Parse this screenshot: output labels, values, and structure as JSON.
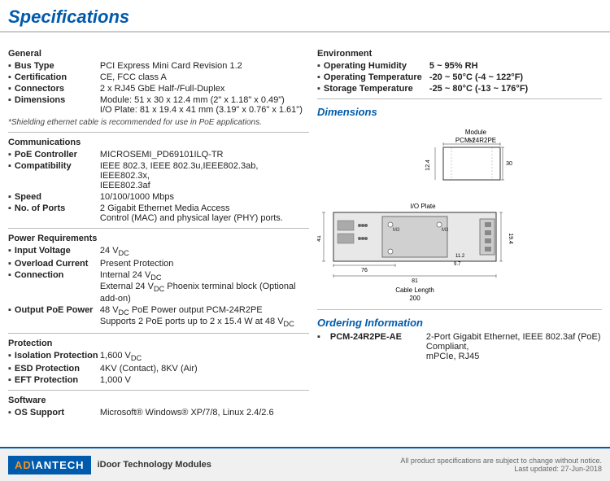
{
  "page": {
    "title": "Specifications"
  },
  "footer": {
    "logo": "AD⋆ANTECH",
    "tagline": "iDoor Technology Modules",
    "note": "All product specifications are subject to change without notice.",
    "date": "Last updated: 27-Jun-2018"
  },
  "left": {
    "general": {
      "title": "General",
      "items": [
        {
          "label": "Bus Type",
          "value": "PCI Express Mini Card Revision 1.2"
        },
        {
          "label": "Certification",
          "value": "CE, FCC class A"
        },
        {
          "label": "Connectors",
          "value": "2 x RJ45 GbE Half-/Full-Duplex"
        },
        {
          "label": "Dimensions",
          "value": "Module: 51 x 30 x 12.4 mm (2\" x 1.18\" x 0.49\")\nI/O Plate: 81 x 19.4 x 41 mm (3.19\" x 0.76\" x 1.61\")"
        }
      ],
      "note": "*Shielding ethernet cable is recommended for use in PoE applications."
    },
    "communications": {
      "title": "Communications",
      "items": [
        {
          "label": "PoE Controller",
          "value": "MICROSEMI_PD69101ILQ-TR"
        },
        {
          "label": "Compatibility",
          "value": "IEEE 802.3, IEEE 802.3u,IEEE802.3ab, IEEE802.3x,\nIEEE802.3af"
        },
        {
          "label": "Speed",
          "value": "10/100/1000 Mbps"
        },
        {
          "label": "No. of Ports",
          "value": "2 Gigabit Ethernet Media Access\nControl (MAC) and physical layer (PHY) ports."
        }
      ]
    },
    "power": {
      "title": "Power Requirements",
      "items": [
        {
          "label": "Input Voltage",
          "value": "24 VDC"
        },
        {
          "label": "Overload Current",
          "value": "Present Protection"
        },
        {
          "label": "Connection",
          "value": "Internal 24 VDC\nExternal 24 VDC Phoenix terminal block (Optional add-on)"
        },
        {
          "label": "Output PoE Power",
          "value": "48 VDC PoE Power output PCM-24R2PE\nSupports 2 PoE ports up to 2 x 15.4 W at 48 VDC"
        }
      ]
    },
    "protection": {
      "title": "Protection",
      "items": [
        {
          "label": "Isolation Protection",
          "value": "1,600 VDC"
        },
        {
          "label": "ESD Protection",
          "value": "4KV (Contact), 8KV (Air)"
        },
        {
          "label": "EFT Protection",
          "value": "1,000 V"
        }
      ]
    },
    "software": {
      "title": "Software",
      "items": [
        {
          "label": "OS Support",
          "value": "Microsoft® Windows® XP/7/8, Linux 2.4/2.6"
        }
      ]
    }
  },
  "right": {
    "environment": {
      "title": "Environment",
      "items": [
        {
          "label": "Operating Humidity",
          "value": "5 ~ 95% RH"
        },
        {
          "label": "Operating Temperature",
          "value": "-20 ~ 50°C (-4 ~ 122°F)"
        },
        {
          "label": "Storage Temperature",
          "value": "-25 ~ 80°C (-13 ~ 176°F)"
        }
      ]
    },
    "dimensions": {
      "title": "Dimensions"
    },
    "ordering": {
      "title": "Ordering Information",
      "items": [
        {
          "label": "PCM-24R2PE-AE",
          "value": "2-Port Gigabit Ethernet, IEEE 802.3af (PoE) Compliant,\nmPCIe, RJ45"
        }
      ]
    }
  }
}
